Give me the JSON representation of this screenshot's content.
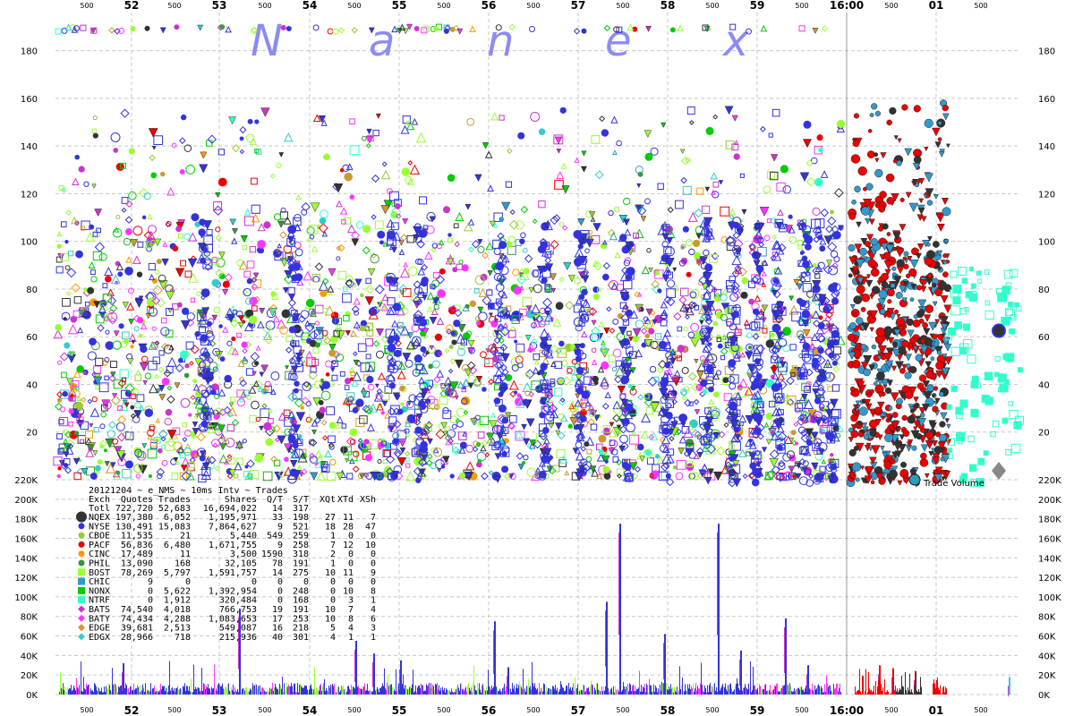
{
  "chart_data": [
    {
      "type": "scatter",
      "title": "",
      "watermark": [
        "N",
        "a",
        "n",
        "e",
        "x"
      ],
      "colors": {
        "NQEX": "#333333",
        "NYSE": "#3333dd",
        "CBOE": "#99cc33",
        "PACF": "#ee0000",
        "CINC": "#ff9900",
        "PHIL": "#339933",
        "BOST": "#99ff33",
        "CHIC": "#3399cc",
        "NONX": "#00cc00",
        "NTRF": "#33ffcc",
        "BATS": "#cc33cc",
        "BATY": "#ff33ff",
        "EDGE": "#cc9933",
        "EDGX": "#33cccc"
      },
      "y_ticks": [
        20,
        40,
        60,
        80,
        100,
        120,
        140,
        160,
        180
      ],
      "ylim": [
        0,
        195
      ],
      "x_major_labels": [
        "52",
        "53",
        "54",
        "55",
        "56",
        "57",
        "58",
        "59",
        "16:00",
        "01"
      ],
      "x_minor_label": "500",
      "dense_until_minute": 9.2,
      "after_close_until": 10.05
    },
    {
      "type": "bar",
      "title": "",
      "annotation": "Trade Volume",
      "y_ticks": [
        "0K",
        "20K",
        "40K",
        "60K",
        "80K",
        "100K",
        "120K",
        "140K",
        "160K",
        "180K",
        "200K",
        "220K"
      ],
      "y_tick_values": [
        0,
        20000,
        40000,
        60000,
        80000,
        100000,
        120000,
        140000,
        160000,
        180000,
        200000,
        220000
      ],
      "ylim": [
        0,
        220000
      ],
      "peaks": [
        {
          "minute": 6.45,
          "value": 175000,
          "color": "#3333dd"
        },
        {
          "minute": 7.55,
          "value": 175000,
          "color": "#3333dd"
        },
        {
          "minute": 6.3,
          "value": 95000,
          "color": "#3333dd"
        },
        {
          "minute": 5.05,
          "value": 75000,
          "color": "#3333dd"
        },
        {
          "minute": 3.7,
          "value": 42000,
          "color": "#3333dd"
        },
        {
          "minute": 3.5,
          "value": 55000,
          "color": "#3333dd"
        },
        {
          "minute": 0.9,
          "value": 32000,
          "color": "#3333dd"
        },
        {
          "minute": 2.2,
          "value": 88000,
          "color": "#3333dd"
        },
        {
          "minute": 4.0,
          "value": 35000,
          "color": "#3333dd"
        },
        {
          "minute": 5.2,
          "value": 28000,
          "color": "#3333dd"
        },
        {
          "minute": 6.95,
          "value": 62000,
          "color": "#3333dd"
        },
        {
          "minute": 7.8,
          "value": 45000,
          "color": "#3333dd"
        },
        {
          "minute": 8.3,
          "value": 78000,
          "color": "#3333dd"
        },
        {
          "minute": 8.55,
          "value": 30000,
          "color": "#3333dd"
        },
        {
          "minute": 9.35,
          "value": 30000,
          "color": "#ee0000"
        },
        {
          "minute": 9.5,
          "value": 27000,
          "color": "#ee0000"
        },
        {
          "minute": 9.75,
          "value": 24000,
          "color": "#ee0000"
        },
        {
          "minute": 10.8,
          "value": 18000,
          "color": "#33cccc"
        }
      ]
    }
  ],
  "legend": {
    "header": "20121204 ~ e_NMS ~ 10ms Intv ~ Trades",
    "columns": [
      "Exch",
      "Quotes",
      "Trades",
      "Shares",
      "Q/T",
      "S/T",
      "XQt",
      "XTd",
      "XSh"
    ],
    "total": [
      "Totl",
      "722,720",
      "52,683",
      "16,694,022",
      "14",
      "317",
      "",
      "",
      ""
    ],
    "rows": [
      [
        "NQEX",
        "197,380",
        "6,052",
        "1,195,971",
        "33",
        "198",
        "27",
        "11",
        "7"
      ],
      [
        "NYSE",
        "130,491",
        "15,083",
        "7,864,627",
        "9",
        "521",
        "18",
        "28",
        "47"
      ],
      [
        "CBOE",
        "11,535",
        "21",
        "5,440",
        "549",
        "259",
        "1",
        "0",
        "0"
      ],
      [
        "PACF",
        "56,836",
        "6,480",
        "1,671,755",
        "9",
        "258",
        "7",
        "12",
        "10"
      ],
      [
        "CINC",
        "17,489",
        "11",
        "3,500",
        "1590",
        "318",
        "2",
        "0",
        "0"
      ],
      [
        "PHIL",
        "13,090",
        "168",
        "32,105",
        "78",
        "191",
        "1",
        "0",
        "0"
      ],
      [
        "BOST",
        "78,269",
        "5,797",
        "1,591,757",
        "14",
        "275",
        "10",
        "11",
        "9"
      ],
      [
        "CHIC",
        "9",
        "0",
        "0",
        "0",
        "0",
        "0",
        "0",
        "0"
      ],
      [
        "NONX",
        "0",
        "5,622",
        "1,392,954",
        "0",
        "248",
        "0",
        "10",
        "8"
      ],
      [
        "NTRF",
        "0",
        "1,912",
        "320,484",
        "0",
        "168",
        "0",
        "3",
        "1"
      ],
      [
        "BATS",
        "74,540",
        "4,018",
        "766,753",
        "19",
        "191",
        "10",
        "7",
        "4"
      ],
      [
        "BATY",
        "74,434",
        "4,288",
        "1,083,653",
        "17",
        "253",
        "10",
        "8",
        "6"
      ],
      [
        "EDGE",
        "39,681",
        "2,513",
        "549,087",
        "16",
        "218",
        "5",
        "4",
        "3"
      ],
      [
        "EDGX",
        "28,966",
        "718",
        "215,936",
        "40",
        "301",
        "4",
        "1",
        "1"
      ]
    ],
    "markers": [
      "circle",
      "circle",
      "circle",
      "circle",
      "circle",
      "circle",
      "square",
      "square",
      "square",
      "square",
      "diamond",
      "diamond",
      "diamond",
      "diamond"
    ]
  }
}
